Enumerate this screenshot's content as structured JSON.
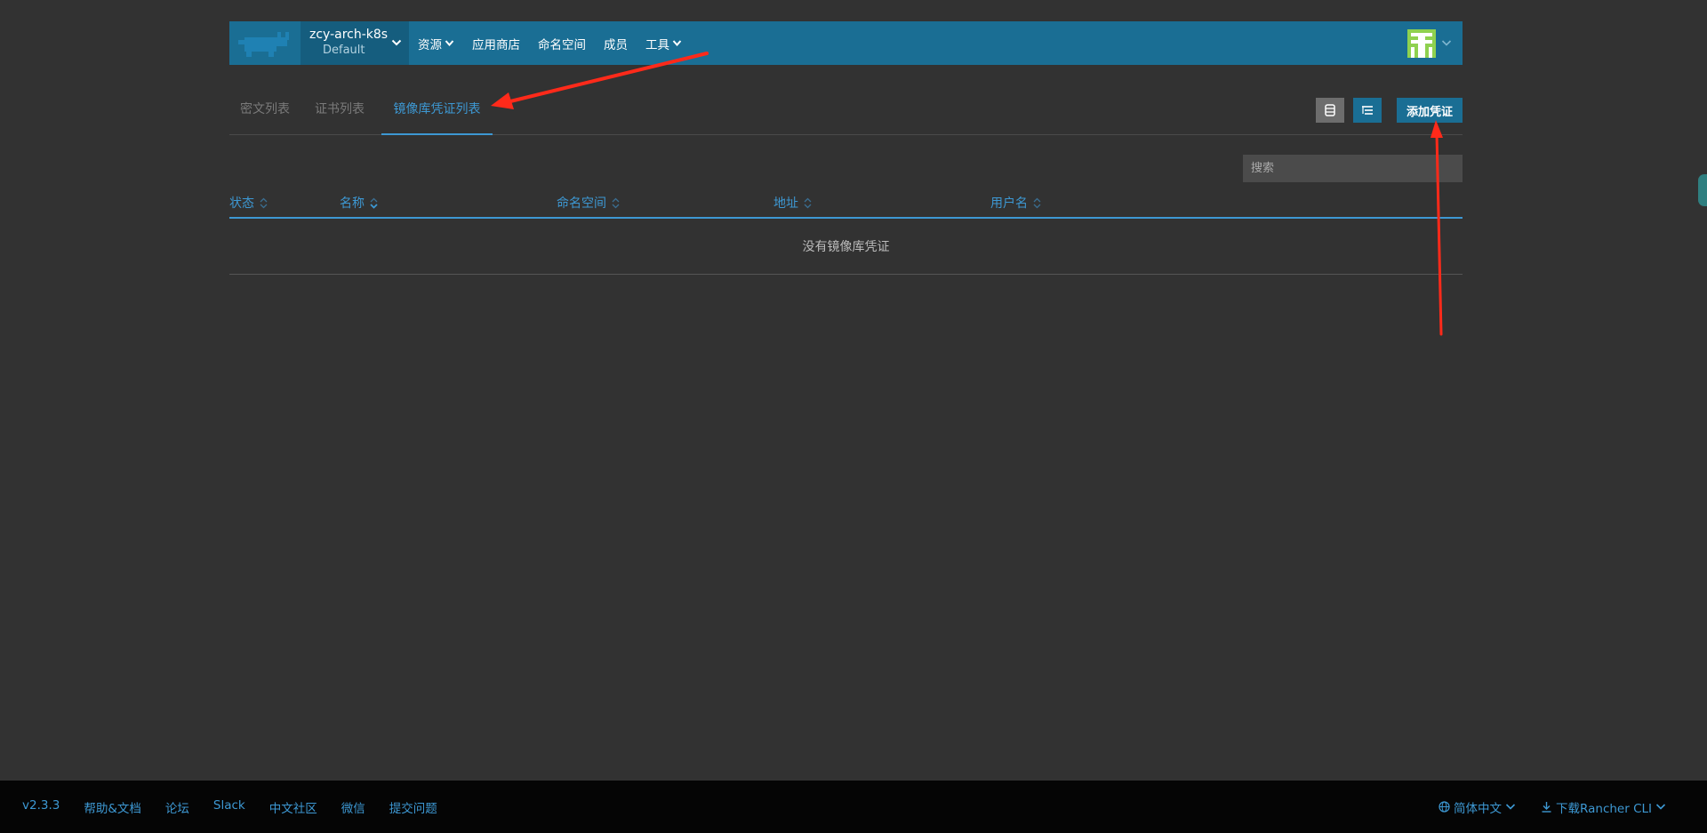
{
  "header": {
    "cluster_name": "zcy-arch-k8s",
    "project_name": "Default",
    "nav": {
      "resources": "资源",
      "app_store": "应用商店",
      "namespaces": "命名空间",
      "members": "成员",
      "tools": "工具"
    }
  },
  "tabs": {
    "secrets": "密文列表",
    "certificates": "证书列表",
    "registries": "镜像库凭证列表"
  },
  "toolbar": {
    "add_label": "添加凭证",
    "search_placeholder": "搜索"
  },
  "table": {
    "columns": [
      "状态",
      "名称",
      "命名空间",
      "地址",
      "用户名"
    ],
    "empty_message": "没有镜像库凭证"
  },
  "footer": {
    "links": [
      "v2.3.3",
      "帮助&文档",
      "论坛",
      "Slack",
      "中文社区",
      "微信",
      "提交问题"
    ],
    "language": "简体中文",
    "download_cli": "下载Rancher CLI"
  },
  "colors": {
    "accent": "#3d98d3",
    "header_bg": "#1a6e94",
    "annotation_arrow": "#ff2a1a"
  }
}
